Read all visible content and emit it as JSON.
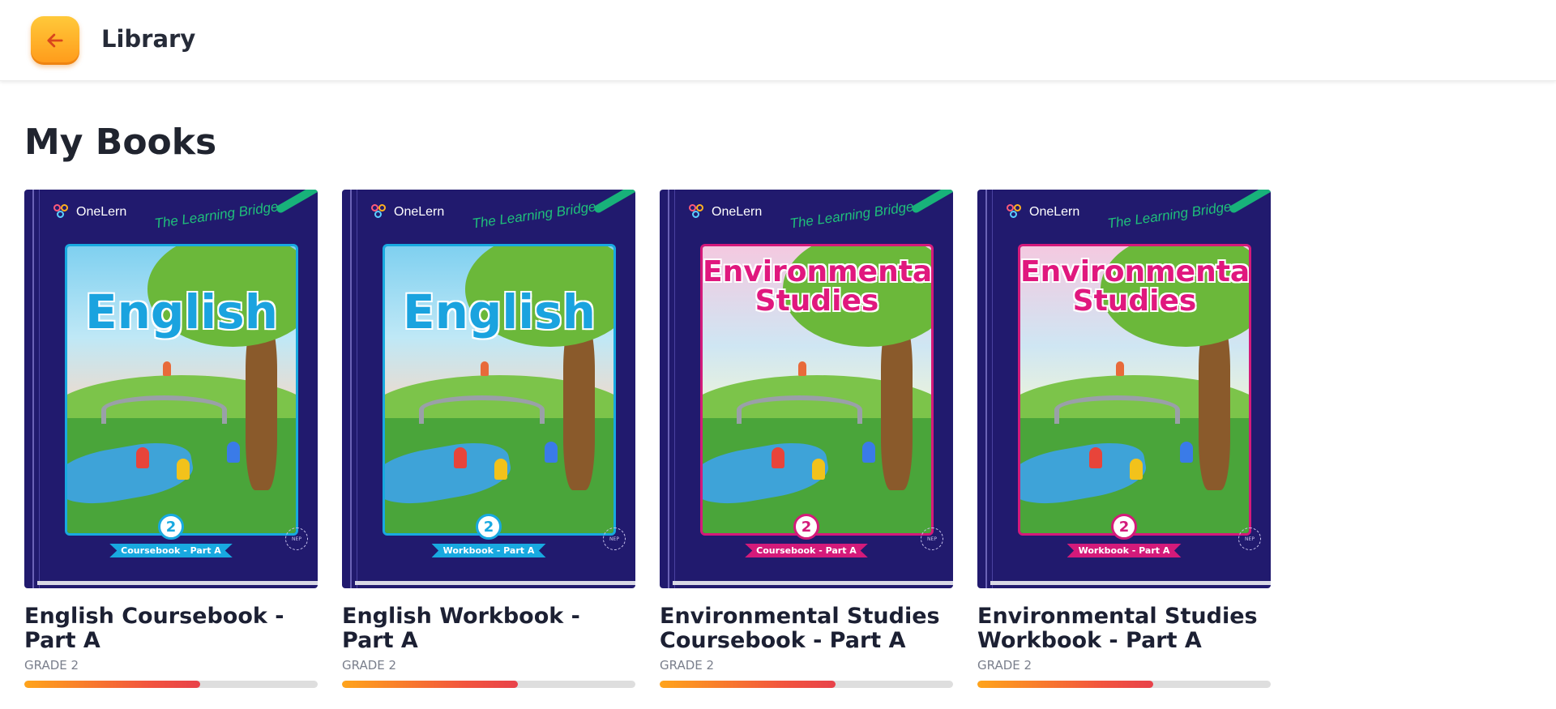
{
  "header": {
    "title": "Library"
  },
  "main": {
    "section_title": "My Books"
  },
  "colors": {
    "accent": "#ff9a1a",
    "cover_bg": "#211a6e"
  },
  "books": [
    {
      "title": "English Coursebook - Part A",
      "grade": "GRADE 2",
      "progress": 0.6,
      "cover": {
        "brand": "OneLern",
        "tagline": "The Learning Bridge",
        "title_lines": [
          "English"
        ],
        "grade_number": "2",
        "ribbon": "Coursebook - Part A",
        "nep": "NEP",
        "frame_color": "#18a9e0",
        "title_color": "#1aa3df",
        "ribbon_color": "#18a9e0"
      }
    },
    {
      "title": "English Workbook - Part A",
      "grade": "GRADE 2",
      "progress": 0.6,
      "cover": {
        "brand": "OneLern",
        "tagline": "The Learning Bridge",
        "title_lines": [
          "English"
        ],
        "grade_number": "2",
        "ribbon": "Workbook - Part A",
        "nep": "NEP",
        "frame_color": "#18a9e0",
        "title_color": "#1aa3df",
        "ribbon_color": "#18a9e0"
      }
    },
    {
      "title": "Environmental Studies Coursebook - Part A",
      "grade": "GRADE 2",
      "progress": 0.6,
      "cover": {
        "brand": "OneLern",
        "tagline": "The Learning Bridge",
        "title_lines": [
          "Environmental",
          "Studies"
        ],
        "grade_number": "2",
        "ribbon": "Coursebook - Part A",
        "nep": "NEP",
        "frame_color": "#d41a7a",
        "title_color": "#e0187e",
        "ribbon_color": "#d41a7a"
      }
    },
    {
      "title": "Environmental Studies Workbook - Part A",
      "grade": "GRADE 2",
      "progress": 0.6,
      "cover": {
        "brand": "OneLern",
        "tagline": "The Learning Bridge",
        "title_lines": [
          "Environmental",
          "Studies"
        ],
        "grade_number": "2",
        "ribbon": "Workbook - Part A",
        "nep": "NEP",
        "frame_color": "#d41a7a",
        "title_color": "#e0187e",
        "ribbon_color": "#d41a7a"
      }
    }
  ]
}
